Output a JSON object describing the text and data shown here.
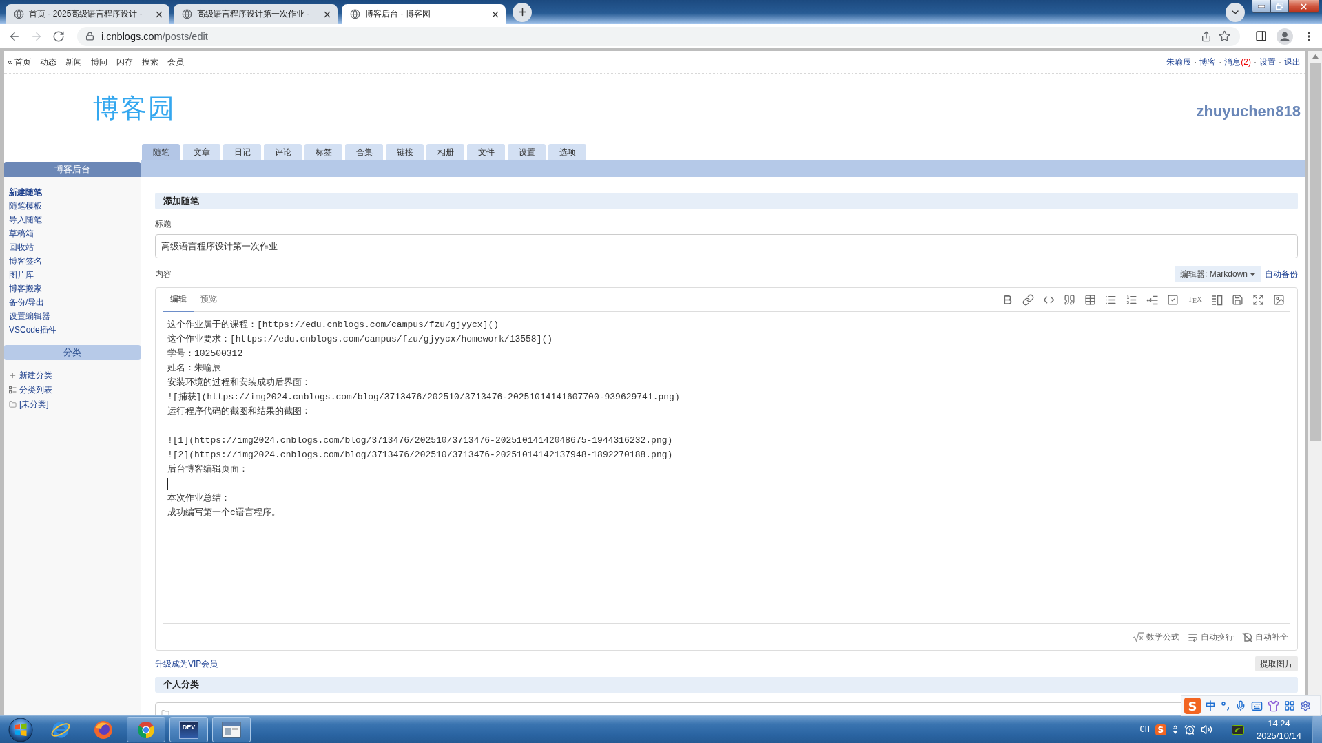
{
  "browser": {
    "tabs": [
      {
        "title": "首页 - 2025高级语言程序设计 -",
        "selected": false
      },
      {
        "title": "高级语言程序设计第一次作业 -",
        "selected": false
      },
      {
        "title": "博客后台 - 博客园",
        "selected": true
      }
    ],
    "nav_buttons": [
      {
        "kind": "back",
        "disabled": false
      },
      {
        "kind": "forward",
        "disabled": true
      },
      {
        "kind": "reload",
        "disabled": false
      }
    ],
    "address": {
      "host": "i.cnblogs.com",
      "path": "/posts/edit"
    }
  },
  "top_nav": {
    "links": [
      "« 首页",
      "动态",
      "新闻",
      "博问",
      "闪存",
      "搜索",
      "会员"
    ],
    "separator": "·",
    "user_links": [
      {
        "label": "朱喻辰"
      },
      {
        "label": "博客"
      },
      {
        "label": "消息",
        "count": "(2)"
      },
      {
        "label": "设置"
      },
      {
        "label": "退出"
      }
    ]
  },
  "header": {
    "logo": "博客园",
    "username": "zhuyuchen818"
  },
  "tabs": [
    {
      "label": "随笔",
      "selected": true
    },
    {
      "label": "文章",
      "selected": false
    },
    {
      "label": "日记",
      "selected": false
    },
    {
      "label": "评论",
      "selected": false
    },
    {
      "label": "标签",
      "selected": false
    },
    {
      "label": "合集",
      "selected": false
    },
    {
      "label": "链接",
      "selected": false
    },
    {
      "label": "相册",
      "selected": false
    },
    {
      "label": "文件",
      "selected": false
    },
    {
      "label": "设置",
      "selected": false
    },
    {
      "label": "选项",
      "selected": false
    }
  ],
  "sidebar": {
    "title": "博客后台",
    "items": [
      {
        "label": "新建随笔",
        "selected": true
      },
      {
        "label": "随笔模板",
        "selected": false
      },
      {
        "label": "导入随笔",
        "selected": false
      },
      {
        "label": "草稿箱",
        "selected": false
      },
      {
        "label": "回收站",
        "selected": false
      },
      {
        "label": "博客签名",
        "selected": false
      },
      {
        "label": "图片库",
        "selected": false
      },
      {
        "label": "博客搬家",
        "selected": false
      },
      {
        "label": "备份/导出",
        "selected": false
      },
      {
        "label": "设置编辑器",
        "selected": false
      },
      {
        "label": "VSCode插件",
        "selected": false
      }
    ],
    "category_title": "分类",
    "category_items": [
      {
        "kind": "add",
        "label": "新建分类"
      },
      {
        "kind": "list",
        "label": "分类列表"
      },
      {
        "kind": "folder",
        "label": "[未分类]"
      }
    ]
  },
  "form": {
    "section_title": "添加随笔",
    "title_label": "标题",
    "title_value": "高级语言程序设计第一次作业",
    "content_label": "内容",
    "editor_select": "编辑器: Markdown",
    "auto_backup": "自动备份",
    "editor_tabs": [
      {
        "label": "编辑",
        "selected": true
      },
      {
        "label": "预览",
        "selected": false
      }
    ],
    "toolbar": [
      {
        "kind": "bold"
      },
      {
        "kind": "link"
      },
      {
        "kind": "code"
      },
      {
        "kind": "quote"
      },
      {
        "kind": "table"
      },
      {
        "kind": "bullet-list"
      },
      {
        "kind": "ordered-list"
      },
      {
        "kind": "outdent"
      },
      {
        "kind": "task"
      },
      {
        "kind": "tex",
        "label": "T$_{E}$X"
      },
      {
        "kind": "split"
      },
      {
        "kind": "save"
      },
      {
        "kind": "fullscreen"
      },
      {
        "kind": "image"
      }
    ],
    "lines": [
      {
        "kind": "text",
        "text": "这个作业属于的课程：[https://edu.cnblogs.com/campus/fzu/gjyycx]()",
        "caret": false
      },
      {
        "kind": "text",
        "text": "这个作业要求：[https://edu.cnblogs.com/campus/fzu/gjyycx/homework/13558]()",
        "caret": false
      },
      {
        "kind": "text",
        "text": "学号：102500312",
        "caret": false
      },
      {
        "kind": "text",
        "text": "姓名：朱喻辰",
        "caret": false
      },
      {
        "kind": "text",
        "text": "安装环境的过程和安装成功后界面：",
        "caret": false
      },
      {
        "kind": "text",
        "text": "![捕获](https://img2024.cnblogs.com/blog/3713476/202510/3713476-20251014141607700-939629741.png)",
        "caret": false
      },
      {
        "kind": "text",
        "text": "运行程序代码的截图和结果的截图：",
        "caret": false
      },
      {
        "kind": "blank",
        "caret": false
      },
      {
        "kind": "text",
        "text": "![1](https://img2024.cnblogs.com/blog/3713476/202510/3713476-20251014142048675-1944316232.png)",
        "caret": false
      },
      {
        "kind": "text",
        "text": "![2](https://img2024.cnblogs.com/blog/3713476/202510/3713476-20251014142137948-1892270188.png)",
        "caret": false
      },
      {
        "kind": "text",
        "text": "后台博客编辑页面：",
        "caret": false
      },
      {
        "kind": "blank",
        "caret": true
      },
      {
        "kind": "text",
        "text": "本次作业总结：",
        "caret": false
      },
      {
        "kind": "text",
        "text": "成功编写第一个c语言程序。",
        "caret": false
      }
    ],
    "footer_options": [
      {
        "kind": "math",
        "label": "数学公式"
      },
      {
        "kind": "wrap",
        "label": "自动换行"
      },
      {
        "kind": "autocomplete",
        "label": "自动补全"
      }
    ],
    "vip_link": "升级成为VIP会员",
    "extract_button": "提取图片",
    "category_section": "个人分类"
  },
  "ime_bar": {
    "logo": "S",
    "mode": "中"
  },
  "taskbar": {
    "apps": [
      {
        "kind": "ie",
        "open": false
      },
      {
        "kind": "firefox",
        "open": false
      },
      {
        "kind": "chrome",
        "open": true
      },
      {
        "kind": "devcpp",
        "logo_text": "DEV",
        "open": true
      },
      {
        "kind": "window",
        "open": true
      }
    ],
    "tray": {
      "language": "CH",
      "ime_logo": "S",
      "time": "14:24",
      "date": "2025/10/14"
    }
  }
}
